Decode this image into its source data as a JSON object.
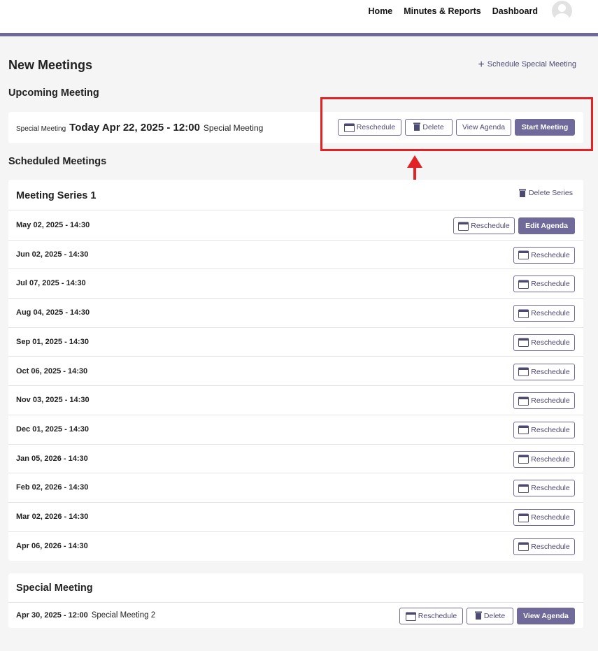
{
  "nav": {
    "home": "Home",
    "minutes_reports": "Minutes & Reports",
    "dashboard": "Dashboard",
    "avatar_icon": "user-avatar-icon"
  },
  "page": {
    "title": "New Meetings",
    "schedule_special": "Schedule Special Meeting"
  },
  "upcoming": {
    "section_title": "Upcoming Meeting",
    "type": "Special Meeting",
    "date": "Today Apr 22, 2025 - 12:00",
    "name": "Special Meeting",
    "buttons": {
      "reschedule": "Reschedule",
      "delete": "Delete",
      "view_agenda": "View Agenda",
      "start_meeting": "Start Meeting"
    }
  },
  "scheduled": {
    "section_title": "Scheduled Meetings",
    "series_title": "Meeting Series 1",
    "delete_series": "Delete Series",
    "reschedule_label": "Reschedule",
    "edit_agenda": "Edit Agenda",
    "rows": [
      "May 02, 2025 - 14:30",
      "Jun 02, 2025 - 14:30",
      "Jul 07, 2025 - 14:30",
      "Aug 04, 2025 - 14:30",
      "Sep 01, 2025 - 14:30",
      "Oct 06, 2025 - 14:30",
      "Nov 03, 2025 - 14:30",
      "Dec 01, 2025 - 14:30",
      "Jan 05, 2026 - 14:30",
      "Feb 02, 2026 - 14:30",
      "Mar 02, 2026 - 14:30",
      "Apr 06, 2026 - 14:30"
    ]
  },
  "special": {
    "title": "Special Meeting",
    "date": "Apr 30, 2025 - 12:00",
    "name": "Special Meeting 2",
    "buttons": {
      "reschedule": "Reschedule",
      "delete": "Delete",
      "view_agenda": "View Agenda"
    }
  },
  "colors": {
    "accent": "#6f6a99",
    "highlight": "#e32226",
    "background": "#f5f5f5"
  }
}
